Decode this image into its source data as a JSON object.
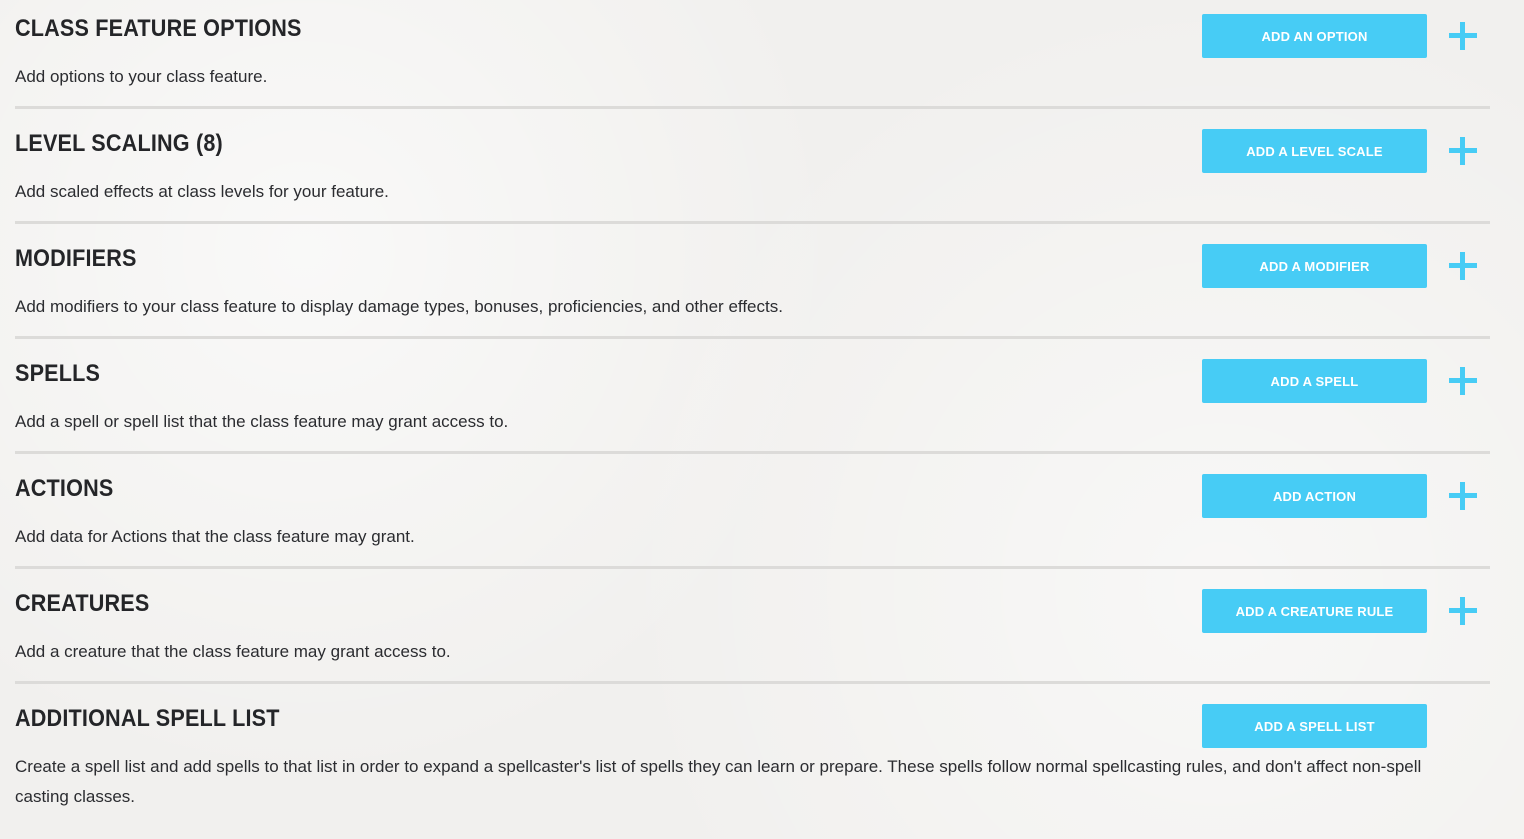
{
  "sections": [
    {
      "title": "CLASS FEATURE OPTIONS",
      "description": "Add options to your class feature.",
      "button_label": "ADD AN OPTION",
      "has_plus": true
    },
    {
      "title": "LEVEL SCALING (8)",
      "description": "Add scaled effects at class levels for your feature.",
      "button_label": "ADD A LEVEL SCALE",
      "has_plus": true
    },
    {
      "title": "MODIFIERS",
      "description": "Add modifiers to your class feature to display damage types, bonuses, proficiencies, and other effects.",
      "button_label": "ADD A MODIFIER",
      "has_plus": true
    },
    {
      "title": "SPELLS",
      "description": "Add a spell or spell list that the class feature may grant access to.",
      "button_label": "ADD A SPELL",
      "has_plus": true
    },
    {
      "title": "ACTIONS",
      "description": "Add data for Actions that the class feature may grant.",
      "button_label": "ADD ACTION",
      "has_plus": true
    },
    {
      "title": "CREATURES",
      "description": "Add a creature that the class feature may grant access to.",
      "button_label": "ADD A CREATURE RULE",
      "has_plus": true
    },
    {
      "title": "ADDITIONAL SPELL LIST",
      "description": "Create a spell list and add spells to that list in order to expand a spellcaster's list of spells they can learn or prepare. These spells follow normal spellcasting rules, and don't affect non-spell casting classes.",
      "button_label": "ADD A SPELL LIST",
      "has_plus": false
    }
  ],
  "colors": {
    "accent": "#47ccf5",
    "text": "#242528",
    "divider": "#dcdbd9",
    "background": "#f1f0ee"
  }
}
